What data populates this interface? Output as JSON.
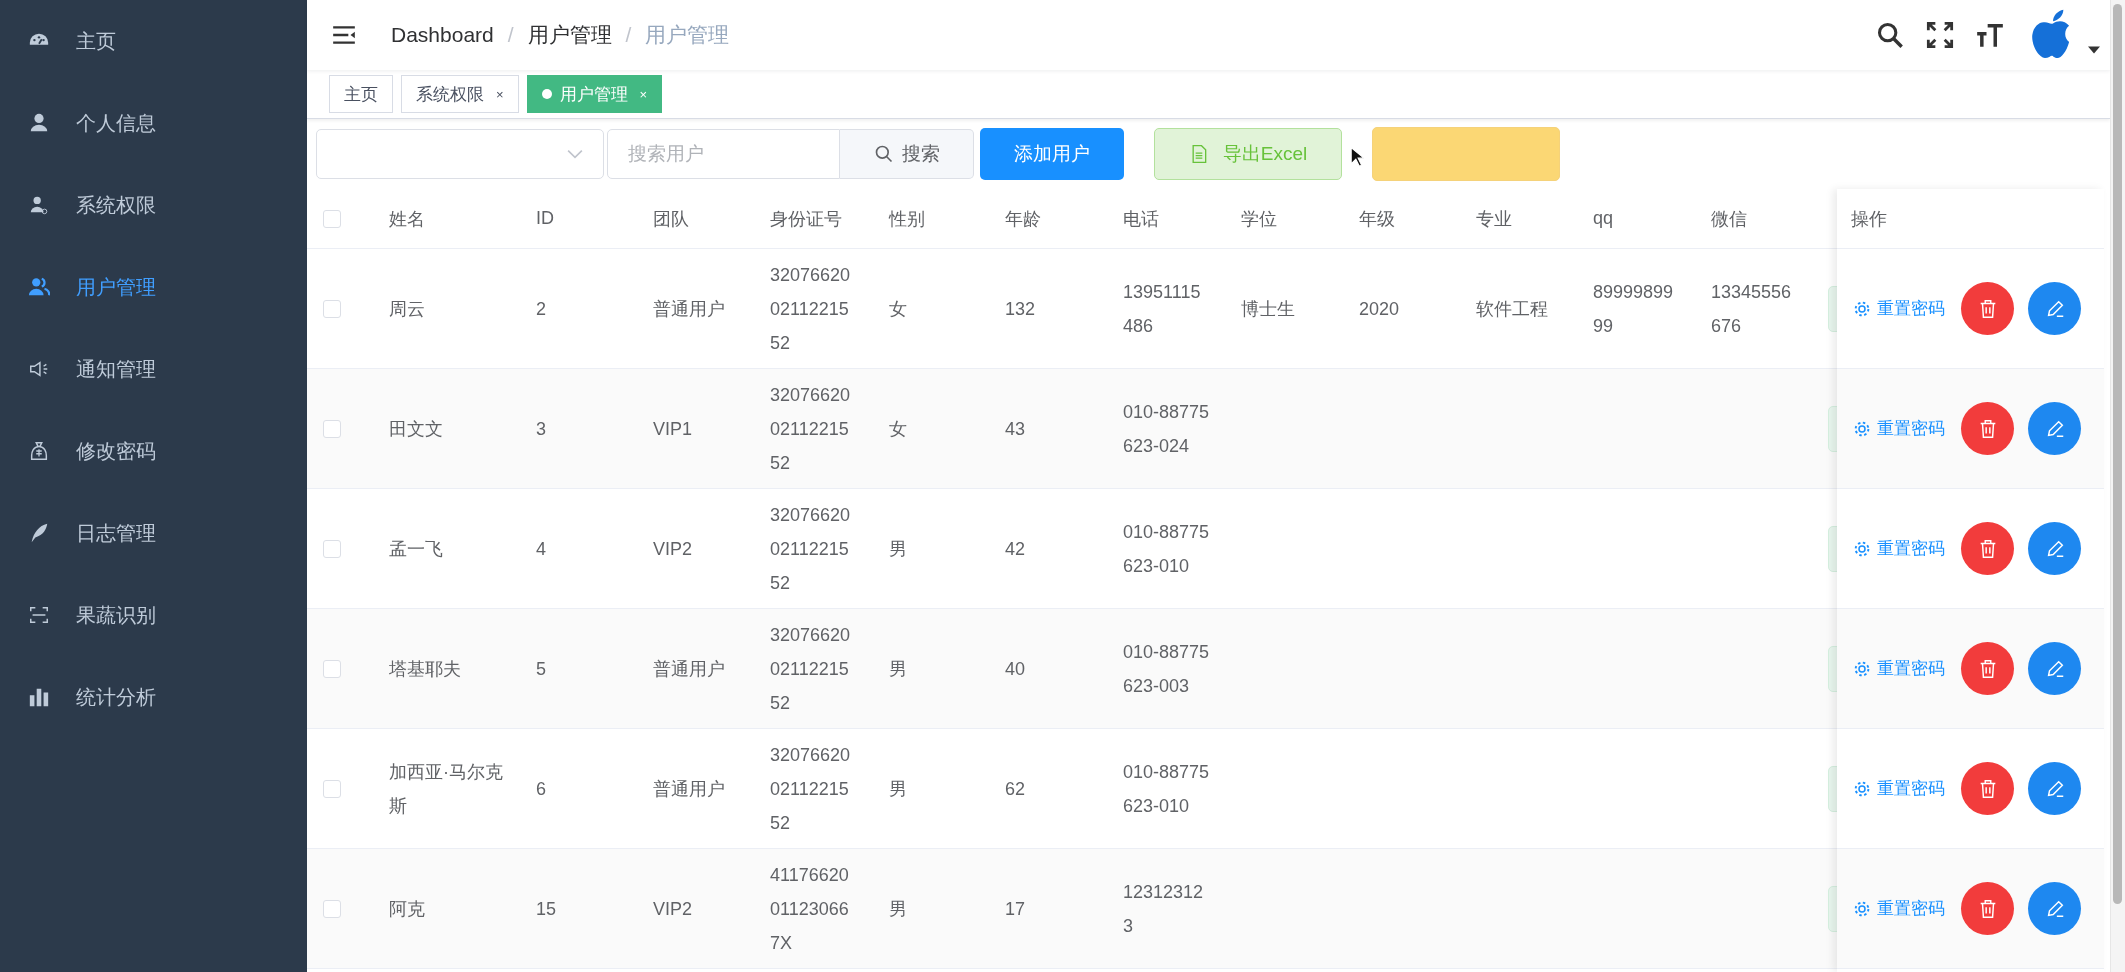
{
  "sidebar": {
    "items": [
      {
        "label": "主页",
        "selected": false
      },
      {
        "label": "个人信息",
        "selected": false
      },
      {
        "label": "系统权限",
        "selected": false
      },
      {
        "label": "用户管理",
        "selected": true
      },
      {
        "label": "通知管理",
        "selected": false
      },
      {
        "label": "修改密码",
        "selected": false
      },
      {
        "label": "日志管理",
        "selected": false
      },
      {
        "label": "果蔬识别",
        "selected": false
      },
      {
        "label": "统计分析",
        "selected": false
      }
    ]
  },
  "header": {
    "breadcrumb": [
      {
        "text": "Dashboard",
        "kind": "link"
      },
      {
        "text": "/",
        "kind": "sep"
      },
      {
        "text": "用户管理",
        "kind": "link"
      },
      {
        "text": "/",
        "kind": "sep"
      },
      {
        "text": "用户管理",
        "kind": "current"
      }
    ]
  },
  "tags": [
    {
      "label": "主页",
      "selected": false
    },
    {
      "label": "系统权限",
      "selected": false,
      "close": "×"
    },
    {
      "label": "用户管理",
      "selected": true,
      "close": "×"
    }
  ],
  "toolbar": {
    "search": {
      "placeholder": "搜索用户"
    },
    "search_button": "搜索",
    "add_button": "添加用户",
    "export_button": "导出Excel"
  },
  "table": {
    "header_checked": false,
    "columns": [
      "姓名",
      "ID",
      "团队",
      "身份证号",
      "性别",
      "年龄",
      "电话",
      "学位",
      "年级",
      "专业",
      "qq",
      "微信"
    ],
    "action_column": "操作",
    "rows": [
      {
        "checked": false,
        "cells": [
          "周云",
          "2",
          "普通用户",
          "320766200211221552",
          "女",
          "132",
          "13951115486",
          "博士生",
          "2020",
          "软件工程",
          "8999989999",
          "13345556676"
        ],
        "reset": "重置密码"
      },
      {
        "checked": false,
        "cells": [
          "田文文",
          "3",
          "VIP1",
          "320766200211221552",
          "女",
          "43",
          "010-88775623-024",
          "",
          "",
          "",
          "",
          ""
        ],
        "reset": "重置密码"
      },
      {
        "checked": false,
        "cells": [
          "孟一飞",
          "4",
          "VIP2",
          "320766200211221552",
          "男",
          "42",
          "010-88775623-010",
          "",
          "",
          "",
          "",
          ""
        ],
        "reset": "重置密码"
      },
      {
        "checked": false,
        "cells": [
          "塔基耶夫",
          "5",
          "普通用户",
          "320766200211221552",
          "男",
          "40",
          "010-88775623-003",
          "",
          "",
          "",
          "",
          ""
        ],
        "reset": "重置密码"
      },
      {
        "checked": false,
        "cells": [
          "加西亚·马尔克斯",
          "6",
          "普通用户",
          "320766200211221552",
          "男",
          "62",
          "010-88775623-010",
          "",
          "",
          "",
          "",
          ""
        ],
        "reset": "重置密码"
      },
      {
        "checked": false,
        "cells": [
          "阿克",
          "15",
          "VIP2",
          "41176620011230667X",
          "男",
          "17",
          "123123123",
          "",
          "",
          "",
          "",
          ""
        ],
        "reset": "重置密码"
      }
    ]
  }
}
